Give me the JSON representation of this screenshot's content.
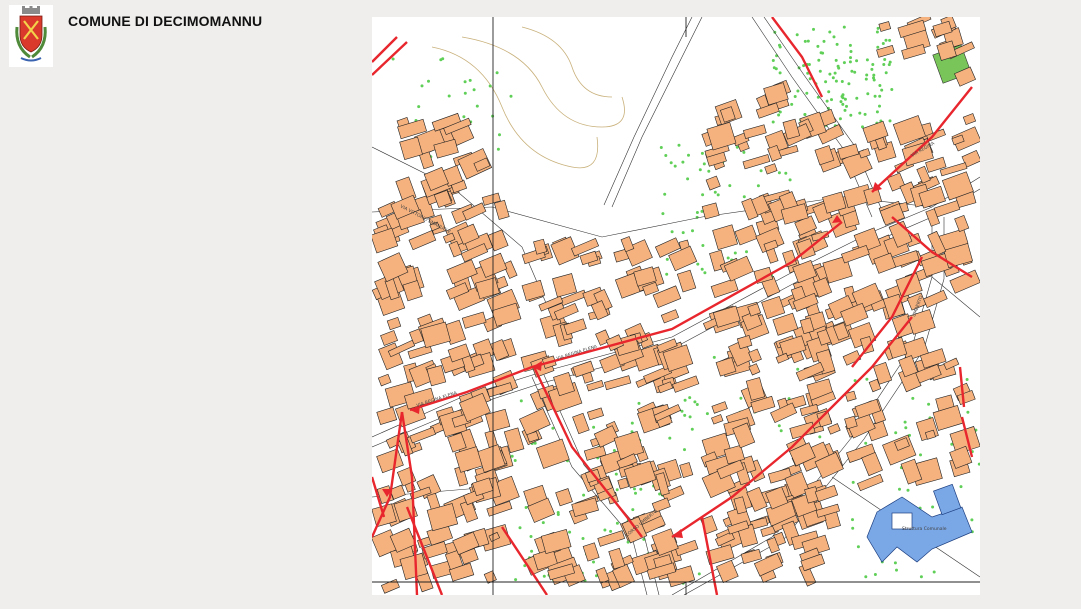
{
  "header": {
    "title": "COMUNE DI DECIMOMANNU",
    "logo_icon": "coat-of-arms-icon"
  },
  "map": {
    "streets": [
      {
        "key": "regina_elena_west",
        "label": "VIA REGINA ELENA"
      },
      {
        "key": "regina_elena_mid",
        "label": "VIA REGINA ELENA"
      },
      {
        "key": "vittorio_emanuele",
        "label": "VIA VITTORIO EMANUELE"
      },
      {
        "key": "umberto_south",
        "label": "CORSO UMBERTO"
      },
      {
        "key": "umberto_east",
        "label": "UMBERTO"
      },
      {
        "key": "regina_ne",
        "label": "VIA REGINA"
      }
    ],
    "landmark_label": "Struttura Comunale",
    "colors": {
      "building": "#f5b27f",
      "building_outline": "#222222",
      "traffic_arrow": "#e8262d",
      "public_building": "#7aa7e6",
      "green_area": "#79c55a",
      "tree_dot": "#5fcf57",
      "contour": "#c8b07a"
    }
  }
}
